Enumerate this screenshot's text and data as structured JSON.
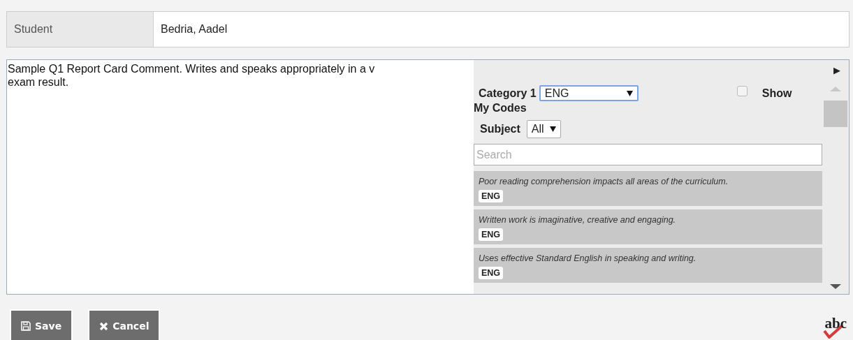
{
  "student": {
    "label": "Student",
    "value": "Bedria, Aadel"
  },
  "comment_lines": [
    "Sample Q1 Report Card Comment. Writes and speaks appropriately in a v",
    "exam result."
  ],
  "panel": {
    "expand": "▶",
    "category_label": "Category 1",
    "category_value": "ENG",
    "show_my_codes": {
      "label_start": "Show",
      "label_end": "My Codes",
      "checked": false
    },
    "subject_label": "Subject",
    "subject_value": "All",
    "search": {
      "placeholder": "Search"
    },
    "comments": [
      {
        "text": "Poor reading comprehension impacts all areas of the curriculum.",
        "tag": "ENG"
      },
      {
        "text": "Written work is imaginative, creative and engaging.",
        "tag": "ENG"
      },
      {
        "text": "Uses effective Standard English in speaking and writing.",
        "tag": "ENG"
      }
    ]
  },
  "buttons": [
    {
      "kind": "save",
      "label": "Save"
    },
    {
      "kind": "cancel",
      "label": "Cancel"
    }
  ],
  "spellcheck": "abc"
}
